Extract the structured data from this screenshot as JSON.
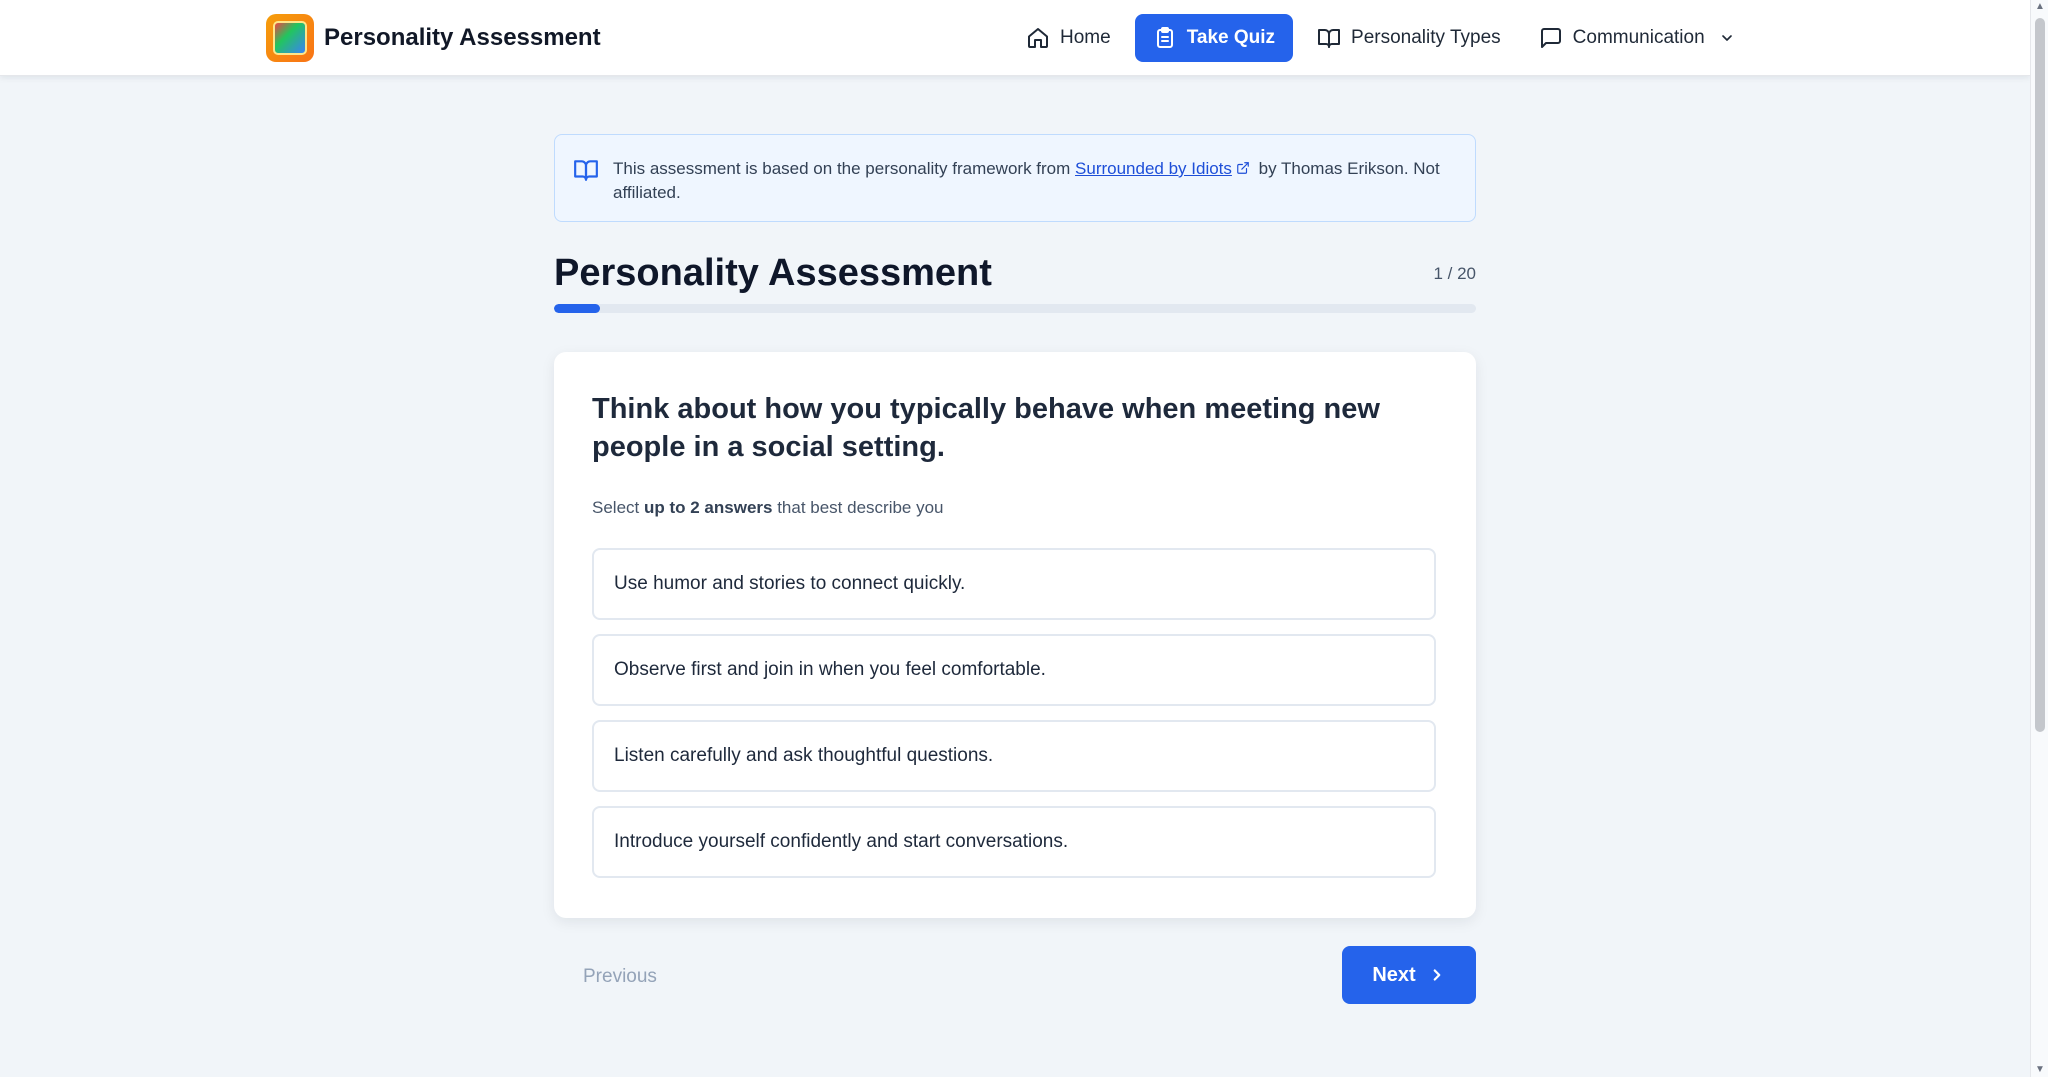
{
  "app": {
    "title": "Personality Assessment"
  },
  "nav": {
    "home": "Home",
    "take_quiz": "Take Quiz",
    "personality_types": "Personality Types",
    "communication": "Communication"
  },
  "notice": {
    "text_before": "This assessment is based on the personality framework from ",
    "link_text": "Surrounded by Idiots",
    "text_after": " by Thomas Erikson. Not affiliated."
  },
  "quiz": {
    "title": "Personality Assessment",
    "progress_label": "1 / 20",
    "current": 1,
    "total": 20,
    "question": "Think about how you typically behave when meeting new people in a social setting.",
    "instruction_prefix": "Select ",
    "instruction_bold": "up to 2 answers",
    "instruction_suffix": " that best describe you",
    "options": [
      "Use humor and stories to connect quickly.",
      "Observe first and join in when you feel comfortable.",
      "Listen carefully and ask thoughtful questions.",
      "Introduce yourself confidently and start conversations."
    ],
    "previous_label": "Previous",
    "next_label": "Next"
  },
  "colors": {
    "accent": "#2563eb",
    "background": "#f1f5f9",
    "notice_bg": "#eff6ff"
  }
}
